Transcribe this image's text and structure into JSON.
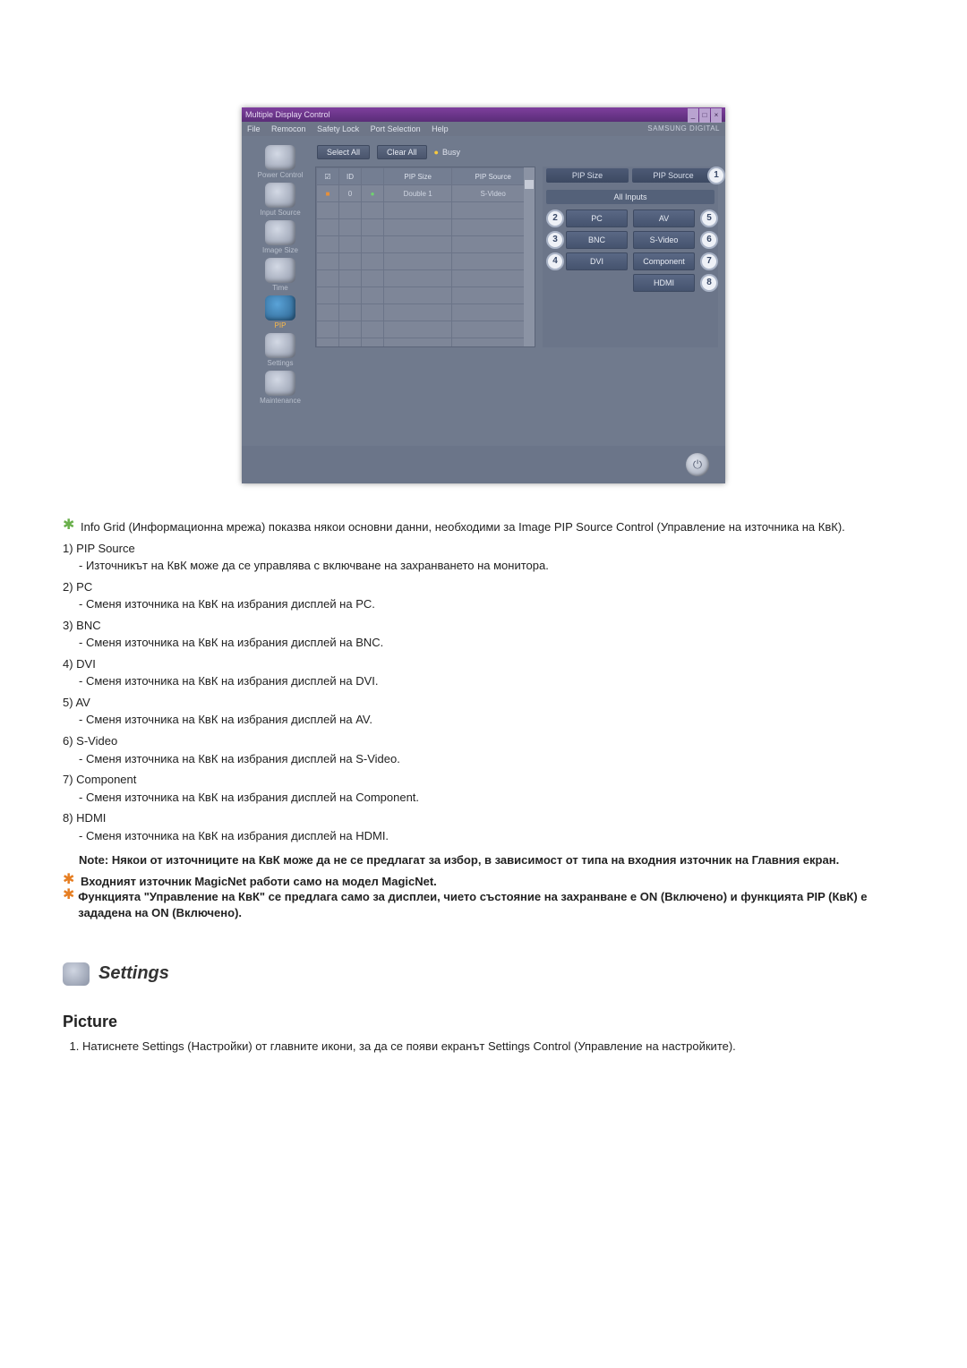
{
  "shot": {
    "title": "Multiple Display Control",
    "menus": [
      "File",
      "Remocon",
      "Safety Lock",
      "Port Selection",
      "Help"
    ],
    "brand": "SAMSUNG DIGITAL",
    "toolbar": {
      "select_all": "Select All",
      "clear_all": "Clear All",
      "busy": "Busy"
    },
    "sidebar": [
      {
        "label": "Power Control"
      },
      {
        "label": "Input Source"
      },
      {
        "label": "Image Size"
      },
      {
        "label": "Time"
      },
      {
        "label": "PIP"
      },
      {
        "label": "Settings"
      },
      {
        "label": "Maintenance"
      }
    ],
    "grid_headers": {
      "chk": "☑",
      "id": "ID",
      "st": "",
      "pip_size": "PIP Size",
      "pip_source": "PIP Source"
    },
    "grid_row": {
      "id": "0",
      "pip_size": "Double 1",
      "pip_source": "S-Video"
    },
    "panel": {
      "pip_size": "PIP Size",
      "pip_source": "PIP Source",
      "all_inputs": "All Inputs",
      "btns": {
        "pc": "PC",
        "av": "AV",
        "bnc": "BNC",
        "svideo": "S-Video",
        "dvi": "DVI",
        "component": "Component",
        "hdmi": "HDMI"
      }
    }
  },
  "callouts": {
    "c1": "1",
    "c2": "2",
    "c3": "3",
    "c4": "4",
    "c5": "5",
    "c6": "6",
    "c7": "7",
    "c8": "8"
  },
  "doc": {
    "intro": "Info Grid (Информационна мрежа) показва някои основни данни, необходими за Image PIP Source Control (Управление на източника на КвК).",
    "items": [
      {
        "head": "1) PIP Source",
        "body": "- Източникът на КвК може да се управлява с включване на захранването на монитора."
      },
      {
        "head": "2) PC",
        "body": "- Сменя източника на КвК на избрания дисплей на PC."
      },
      {
        "head": "3) BNC",
        "body": "- Сменя източника на КвК на избрания дисплей на BNC."
      },
      {
        "head": "4) DVI",
        "body": "- Сменя източника на КвК на избрания дисплей на DVI."
      },
      {
        "head": "5) AV",
        "body": "- Сменя източника на КвК на избрания дисплей на AV."
      },
      {
        "head": "6) S-Video",
        "body": "- Сменя източника на КвК на избрания дисплей на S-Video."
      },
      {
        "head": "7) Component",
        "body": "- Сменя източника на КвК на избрания дисплей на Component."
      },
      {
        "head": "8) HDMI",
        "body": "- Сменя източника на КвК на избрания дисплей на HDMI."
      }
    ],
    "note": "Note: Някои от източниците на КвК може да не се предлагат за избор, в зависимост от типа на входния източник на Главния екран.",
    "bullet1": "Входният източник MagicNet работи само на модел MagicNet.",
    "bullet2": "Функцията \"Управление на КвК\" се предлага само за дисплеи, чието състояние на захранване е ON (Включено) и функцията PIP (КвК) е зададена на ON (Включено).",
    "settings_heading": "Settings",
    "picture_heading": "Picture",
    "step1": "Натиснете Settings (Настройки) от главните икони, за да се появи екранът Settings Control (Управление на настройките)."
  }
}
